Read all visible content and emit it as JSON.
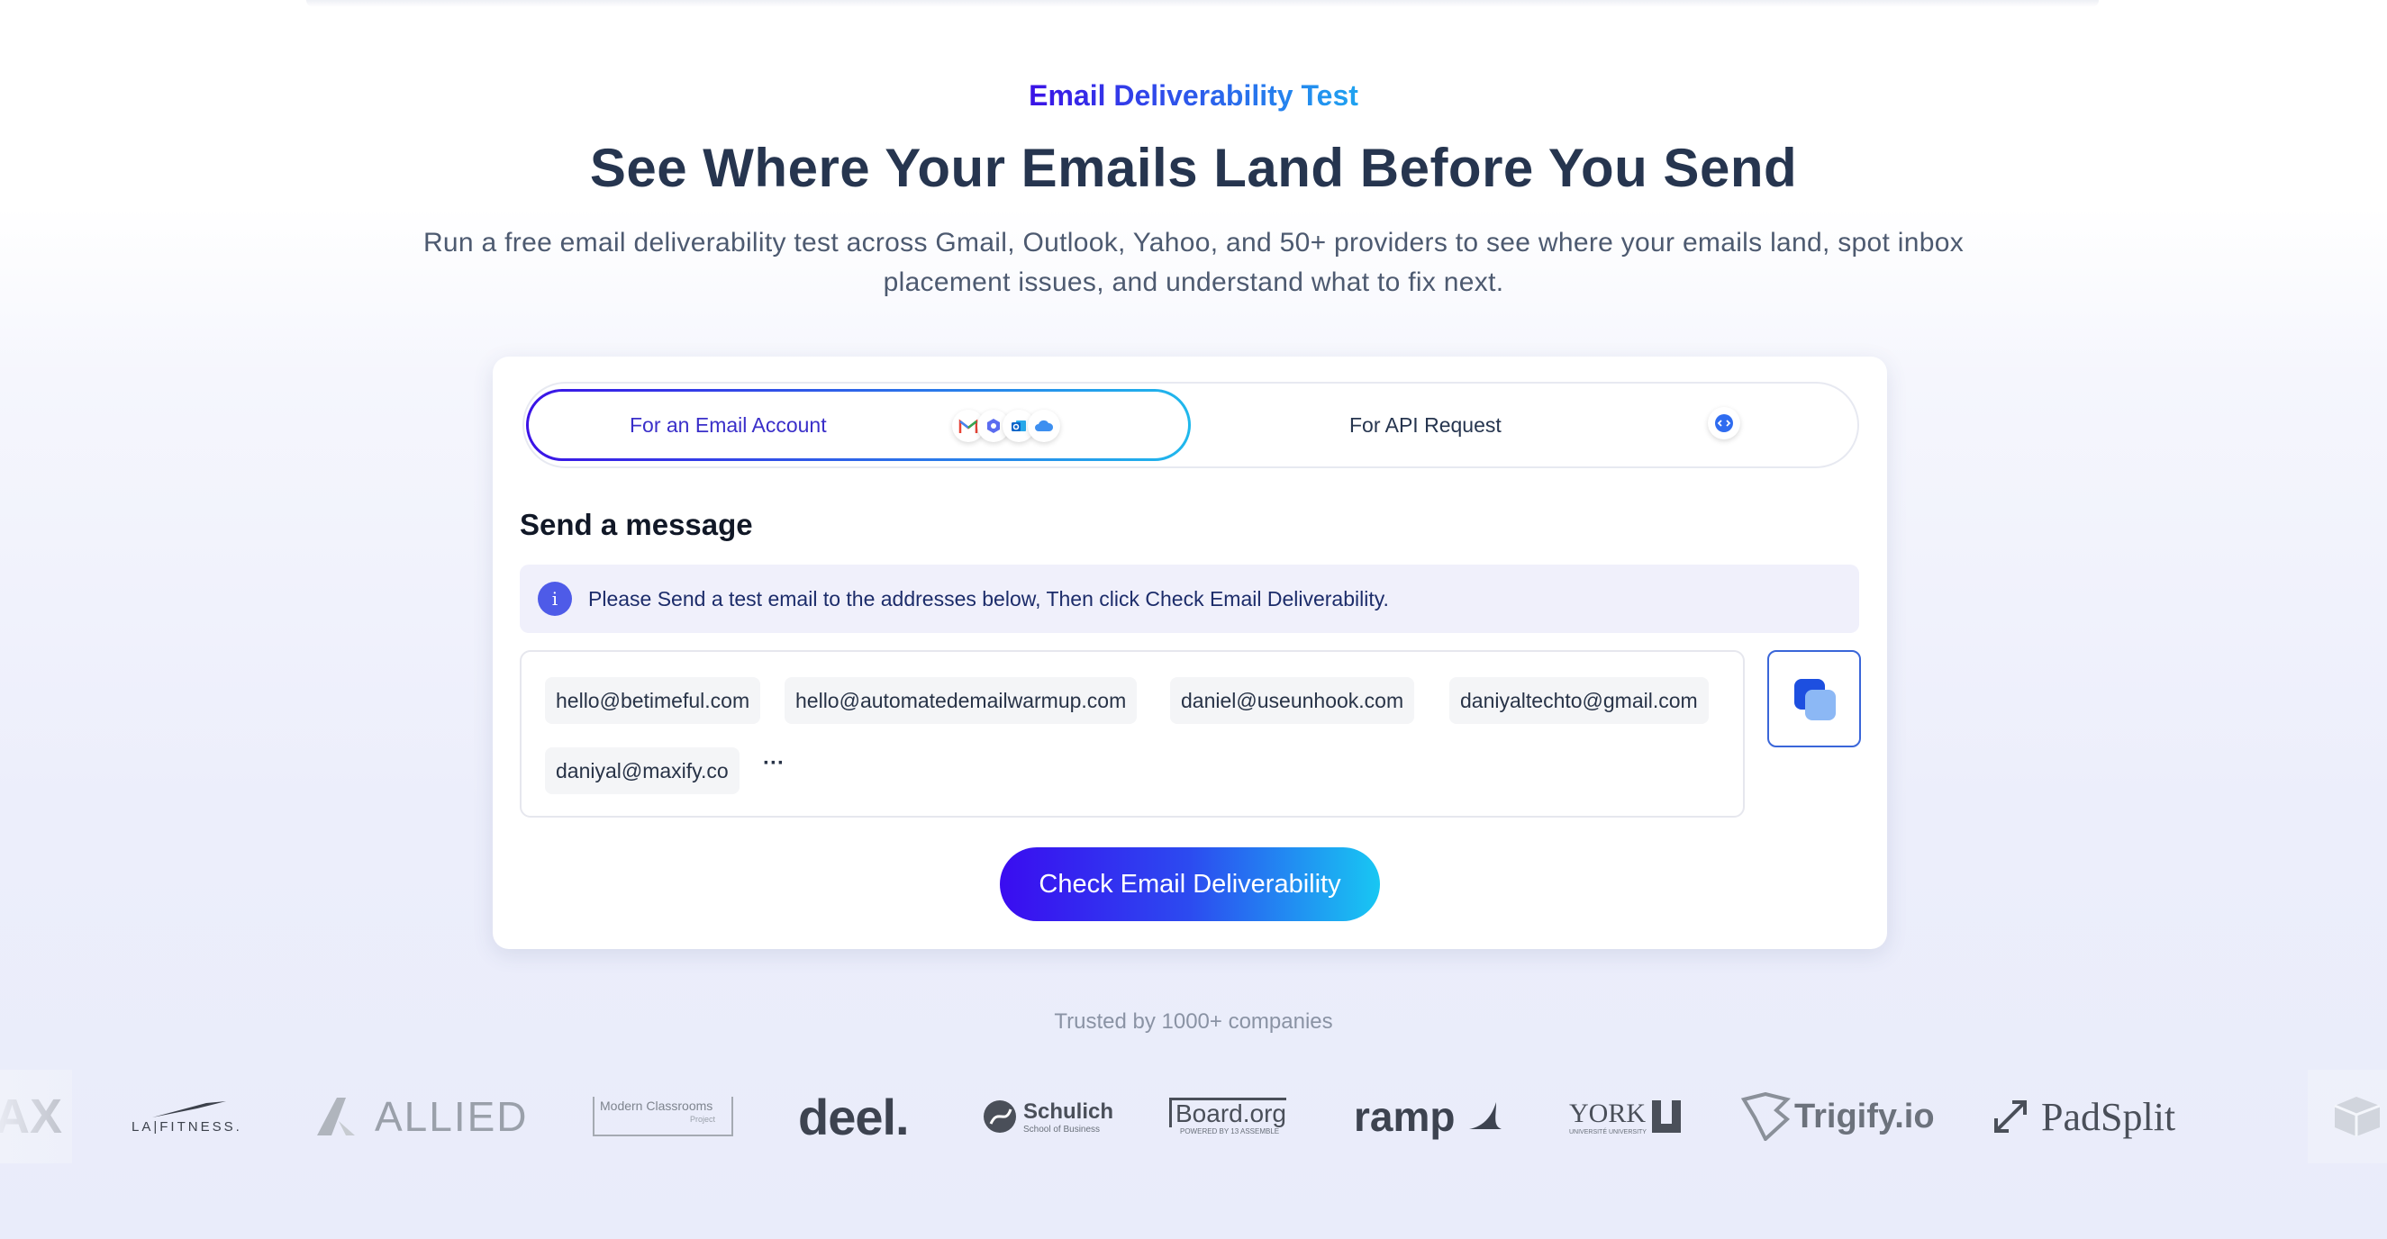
{
  "hero": {
    "eyebrow": "Email Deliverability Test",
    "title": "See Where Your Emails Land Before You Send",
    "subtitle": "Run a free email deliverability test across Gmail, Outlook, Yahoo, and 50+ providers to see where your emails land, spot inbox placement issues, and understand what to fix next."
  },
  "tabs": [
    {
      "label": "For an Email Account",
      "icons": [
        "gmail-icon",
        "proton-icon",
        "outlook-icon",
        "icloud-icon"
      ],
      "active": true
    },
    {
      "label": "For API Request",
      "icons": [
        "code-icon"
      ],
      "active": false
    }
  ],
  "send_message": {
    "title": "Send a message",
    "info": "Please Send a test email to the addresses below, Then click Check Email Deliverability.",
    "emails": [
      "hello@betimeful.com",
      "hello@automatedemailwarmup.com",
      "daniel@useunhook.com",
      "daniyaltechto@gmail.com",
      "daniyal@maxify.co"
    ],
    "more": "···",
    "copy_icon": "copy-icon",
    "cta_label": "Check Email Deliverability"
  },
  "trusted": {
    "label": "Trusted by 1000+ companies",
    "logos": [
      "AX",
      "LA|FITNESS.",
      "ALLIED",
      "Modern Classrooms",
      "deel.",
      "Schulich",
      "Board.org",
      "ramp",
      "YORK",
      "Trigify.io",
      "PadSplit"
    ],
    "logo_sublabels": {
      "modern_classrooms": "Project",
      "schulich": "School of Business",
      "board": "POWERED BY 13 ASSEMBLE",
      "york": "UNIVERSITÉ UNIVERSITY"
    }
  },
  "colors": {
    "accent_start": "#3a12e6",
    "accent_end": "#1fb8ec",
    "title": "#26354f",
    "info_bg": "#f0f0fb"
  }
}
